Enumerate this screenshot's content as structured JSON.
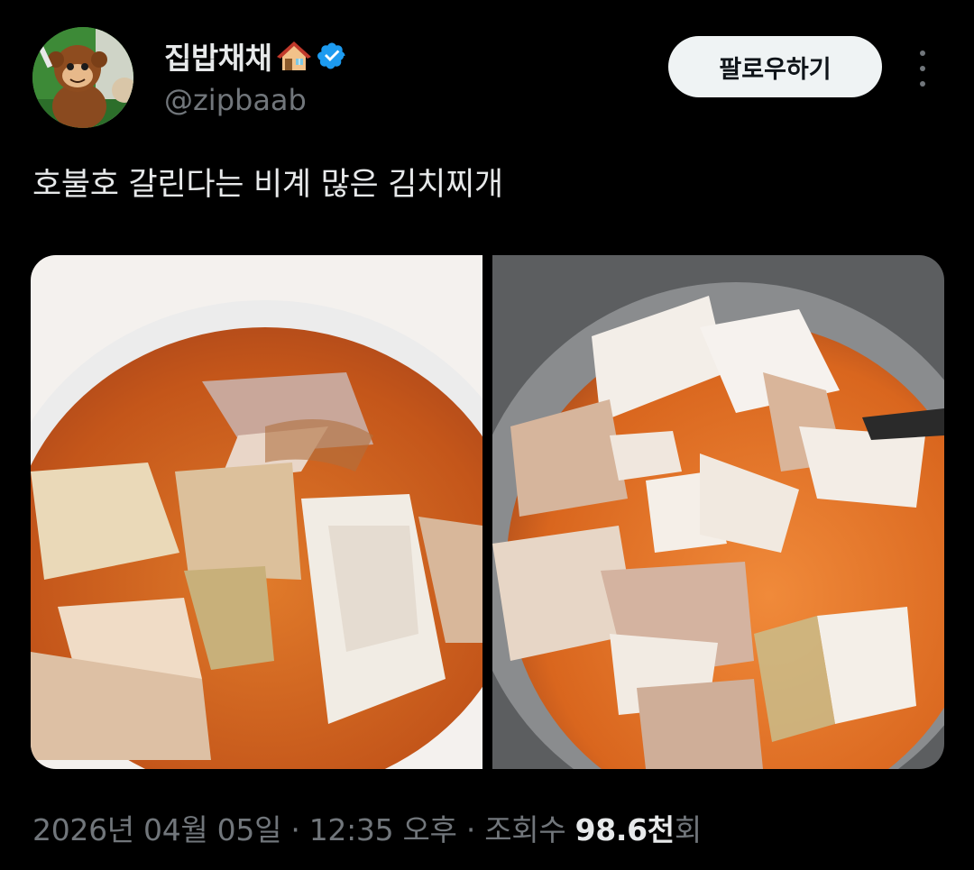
{
  "user": {
    "display_name": "집밥채채",
    "handle": "@zipbaab",
    "verified": true,
    "name_emoji": "house-emoji"
  },
  "follow_label": "팔로우하기",
  "tweet_text": "호불호 갈린다는 비계 많은 김치찌개",
  "media": [
    {
      "icon": "kimchi-stew-bowl-photo"
    },
    {
      "icon": "kimchi-stew-pot-photo"
    }
  ],
  "meta": {
    "date": "2026년 04월 05일",
    "sep1": " · ",
    "time": "12:35 오후",
    "sep2": " · ",
    "views_prefix": "조회수 ",
    "views_count": "98.6천",
    "views_suffix": "회"
  },
  "colors": {
    "background": "#000000",
    "text": "#e7e9ea",
    "secondary": "#71767b",
    "verified": "#1d9bf0",
    "follow_bg": "#eff3f4"
  }
}
